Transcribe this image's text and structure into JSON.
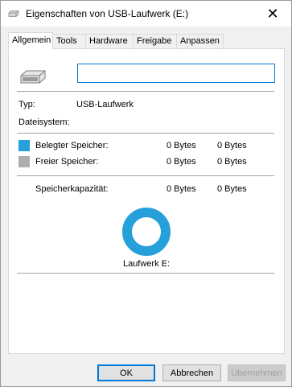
{
  "window": {
    "title": "Eigenschaften von USB-Laufwerk (E:)",
    "close_glyph": "✕"
  },
  "tabs": [
    {
      "label": "Allgemein",
      "active": true
    },
    {
      "label": "Tools",
      "active": false
    },
    {
      "label": "Hardware",
      "active": false
    },
    {
      "label": "Freigabe",
      "active": false
    },
    {
      "label": "Anpassen",
      "active": false
    }
  ],
  "general": {
    "name_value": "",
    "type_label": "Typ:",
    "type_value": "USB-Laufwerk",
    "filesystem_label": "Dateisystem:",
    "filesystem_value": "",
    "used_label": "Belegter Speicher:",
    "used_bytes": "0 Bytes",
    "used_short": "0 Bytes",
    "free_label": "Freier Speicher:",
    "free_bytes": "0 Bytes",
    "free_short": "0 Bytes",
    "capacity_label": "Speicherkapazität:",
    "capacity_bytes": "0 Bytes",
    "capacity_short": "0 Bytes",
    "drive_label": "Laufwerk E:"
  },
  "colors": {
    "used": "#26a0da",
    "free": "#adadad",
    "accent": "#0078d7"
  },
  "icons": {
    "title": "usb-drive-icon",
    "drive": "usb-drive-icon",
    "close": "close-icon"
  },
  "buttons": {
    "ok": "OK",
    "cancel": "Abbrechen",
    "apply": "Übernehmen"
  }
}
